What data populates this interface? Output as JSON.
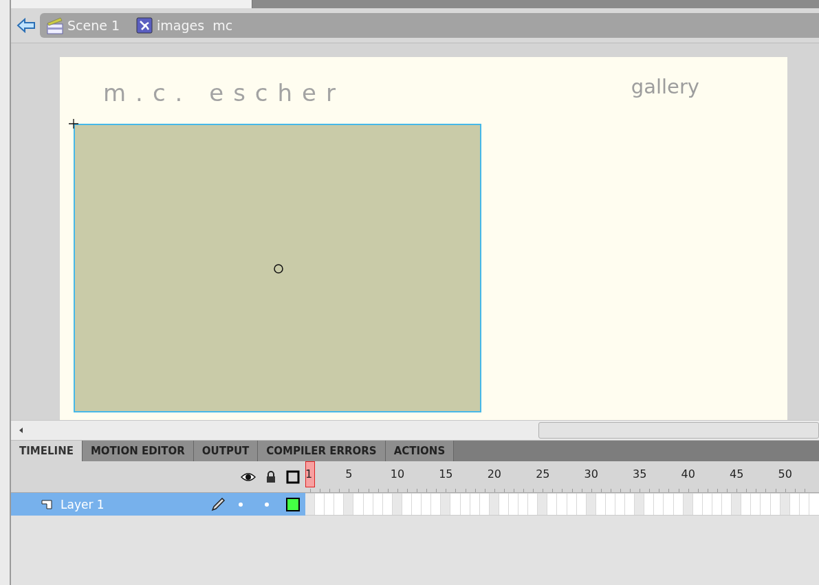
{
  "breadcrumb": [
    {
      "kind": "scene",
      "label": "Scene 1"
    },
    {
      "kind": "symbol",
      "label": "images  mc"
    }
  ],
  "stage": {
    "title": "m.c. escher",
    "subtitle": "gallery",
    "selected": true
  },
  "panel_tabs": [
    {
      "label": "TIMELINE",
      "selected": true
    },
    {
      "label": "MOTION EDITOR",
      "selected": false
    },
    {
      "label": "OUTPUT",
      "selected": false
    },
    {
      "label": "COMPILER ERRORS",
      "selected": false
    },
    {
      "label": "ACTIONS",
      "selected": false
    }
  ],
  "frame_numbers": [
    "1",
    "5",
    "10",
    "15",
    "20",
    "25",
    "30",
    "35",
    "40",
    "45",
    "50"
  ],
  "layers": [
    {
      "name": "Layer 1",
      "selected": true,
      "editing": true,
      "color": "#44ff44"
    }
  ]
}
